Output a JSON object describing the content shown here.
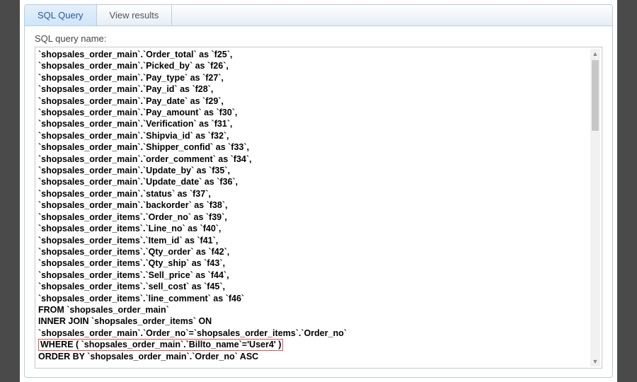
{
  "tabs": {
    "sql_query": "SQL Query",
    "view_results": "View results"
  },
  "label_query_name": "SQL query name:",
  "query_lines": [
    "`shopsales_order_main`.`Order_total` as `f25`,",
    "`shopsales_order_main`.`Picked_by` as `f26`,",
    "`shopsales_order_main`.`Pay_type` as `f27`,",
    "`shopsales_order_main`.`Pay_id` as `f28`,",
    "`shopsales_order_main`.`Pay_date` as `f29`,",
    "`shopsales_order_main`.`Pay_amount` as `f30`,",
    "`shopsales_order_main`.`Verification` as `f31`,",
    "`shopsales_order_main`.`Shipvia_id` as `f32`,",
    "`shopsales_order_main`.`Shipper_confid` as `f33`,",
    "`shopsales_order_main`.`order_comment` as `f34`,",
    "`shopsales_order_main`.`Update_by` as `f35`,",
    "`shopsales_order_main`.`Update_date` as `f36`,",
    "`shopsales_order_main`.`status` as `f37`,",
    "`shopsales_order_main`.`backorder` as `f38`,",
    "`shopsales_order_items`.`Order_no` as `f39`,",
    "`shopsales_order_items`.`Line_no` as `f40`,",
    "`shopsales_order_items`.`Item_id` as `f41`,",
    "`shopsales_order_items`.`Qty_order` as `f42`,",
    "`shopsales_order_items`.`Qty_ship` as `f43`,",
    "`shopsales_order_items`.`Sell_price` as `f44`,",
    "`shopsales_order_items`.`sell_cost` as `f45`,",
    "`shopsales_order_items`.`line_comment` as `f46`",
    "FROM `shopsales_order_main`",
    "INNER JOIN  `shopsales_order_items` ON",
    "`shopsales_order_main`.`Order_no`=`shopsales_order_items`.`Order_no`"
  ],
  "highlighted_line": "WHERE ( `shopsales_order_main`.`Billto_name`='User4' )",
  "last_line": "ORDER BY `shopsales_order_main`.`Order_no` ASC"
}
